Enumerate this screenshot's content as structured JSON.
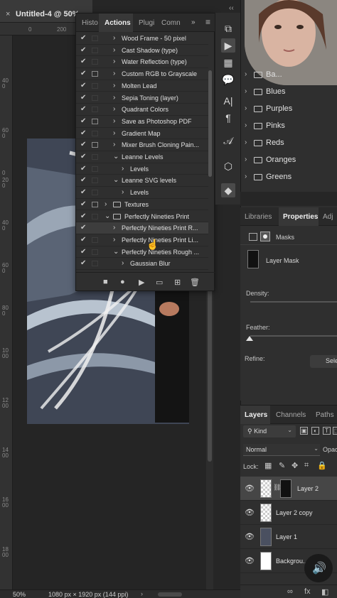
{
  "document": {
    "tab_close": "×",
    "tab_title": "Untitled-4 @ 50%",
    "ruler_top": [
      "0",
      "200"
    ],
    "ruler_left": [
      "400",
      "600",
      "0",
      "200",
      "400",
      "600",
      "800",
      "1000",
      "1200",
      "1400",
      "1600",
      "1800"
    ]
  },
  "status_bar": {
    "zoom": "50%",
    "info": "1080 px × 1920 px (144 ppi)",
    "arrow": "›"
  },
  "actions_panel": {
    "tabs": [
      "Histo",
      "Actions",
      "Plugi",
      "Comn"
    ],
    "more_glyph": "»",
    "menu_glyph": "≡",
    "items": [
      {
        "label": "Wood Frame - 50 pixel",
        "dialog": false,
        "indent": 1,
        "twisty": "›"
      },
      {
        "label": "Cast Shadow (type)",
        "dialog": false,
        "indent": 1,
        "twisty": "›"
      },
      {
        "label": "Water Reflection (type)",
        "dialog": false,
        "indent": 1,
        "twisty": "›"
      },
      {
        "label": "Custom RGB to Grayscale",
        "dialog": true,
        "indent": 1,
        "twisty": "›"
      },
      {
        "label": "Molten Lead",
        "dialog": false,
        "indent": 1,
        "twisty": "›"
      },
      {
        "label": "Sepia Toning (layer)",
        "dialog": false,
        "indent": 1,
        "twisty": "›"
      },
      {
        "label": "Quadrant Colors",
        "dialog": false,
        "indent": 1,
        "twisty": "›"
      },
      {
        "label": "Save as Photoshop PDF",
        "dialog": true,
        "indent": 1,
        "twisty": "›"
      },
      {
        "label": "Gradient Map",
        "dialog": false,
        "indent": 1,
        "twisty": "›"
      },
      {
        "label": "Mixer Brush Cloning Pain...",
        "dialog": true,
        "indent": 1,
        "twisty": "›"
      },
      {
        "label": "Leanne Levels",
        "dialog": false,
        "indent": 1,
        "twisty": "⌄"
      },
      {
        "label": "Levels",
        "dialog": false,
        "indent": 2,
        "twisty": "›"
      },
      {
        "label": "Leanne SVG levels",
        "dialog": false,
        "indent": 1,
        "twisty": "⌄"
      },
      {
        "label": "Levels",
        "dialog": false,
        "indent": 2,
        "twisty": "›"
      },
      {
        "label": "Textures",
        "dialog": true,
        "indent": 0,
        "twisty": "›",
        "folder": true
      },
      {
        "label": "Perfectly Nineties Print",
        "dialog": false,
        "indent": 0,
        "twisty": "⌄",
        "folder": true
      },
      {
        "label": "Perfectly Nineties Print R...",
        "dialog": false,
        "indent": 1,
        "twisty": "›",
        "selected": true
      },
      {
        "label": "Perfectly Nineties Print Li...",
        "dialog": false,
        "indent": 1,
        "twisty": "›"
      },
      {
        "label": "Perfectly Nineties Rough ...",
        "dialog": false,
        "indent": 1,
        "twisty": "⌄"
      },
      {
        "label": "Gaussian Blur",
        "dialog": false,
        "indent": 2,
        "twisty": "›"
      }
    ],
    "check": "✔",
    "toolbar": [
      "■",
      "●",
      "▶",
      "▭",
      "⊞",
      "🗑"
    ]
  },
  "icon_strip": {
    "collapse": "‹‹",
    "icons": [
      "⧉",
      "▶",
      "▦",
      "💬",
      "A|",
      "¶",
      "𝒜",
      "⬡",
      "◆"
    ]
  },
  "swatches": {
    "folders": [
      "Ba...",
      "Blues",
      "Purples",
      "Pinks",
      "Reds",
      "Oranges",
      "Greens"
    ]
  },
  "properties_panel": {
    "tabs": [
      "Libraries",
      "Properties",
      "Adj"
    ],
    "masks_label": "Masks",
    "layer_mask_label": "Layer Mask",
    "density_label": "Density:",
    "feather_label": "Feather:",
    "refine_label": "Refine:",
    "select_button": "Sele"
  },
  "layers_panel": {
    "tabs": [
      "Layers",
      "Channels",
      "Paths"
    ],
    "kind_label": "Kind",
    "kind_icons": [
      "▣",
      "◐",
      "T",
      "⬚"
    ],
    "blend_mode": "Normal",
    "opacity_label": "Opac",
    "lock_label": "Lock:",
    "lock_icons": [
      "▦",
      "✎",
      "✥",
      "⌗",
      "🔒"
    ],
    "layers": [
      {
        "name": "Layer 2",
        "selected": true,
        "eye": "👁"
      },
      {
        "name": "Layer 2 copy",
        "selected": false,
        "eye": "👁"
      },
      {
        "name": "Layer 1",
        "selected": false,
        "eye": "👁"
      },
      {
        "name": "Backgrou...",
        "selected": false,
        "eye": "👁"
      }
    ],
    "footer_icons": [
      "∞",
      "fx",
      "◧"
    ]
  },
  "volume_icon": "🔊"
}
